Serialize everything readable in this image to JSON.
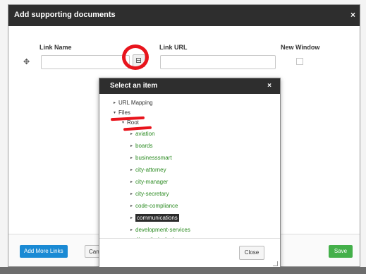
{
  "dialog": {
    "title": "Add supporting documents",
    "close_icon": "×",
    "columns": {
      "link_name": "Link Name",
      "link_url": "Link URL",
      "new_window": "New Window"
    },
    "row": {
      "link_name_value": "",
      "link_url_value": "",
      "new_window_checked": false
    },
    "add_row_icon": "✥",
    "buttons": {
      "add_more": "Add More Links",
      "cancel": "Canc",
      "save": "Save"
    }
  },
  "picker": {
    "title": "Select an item",
    "close_icon": "×",
    "tree": [
      {
        "label": "URL Mapping",
        "arrow": "▸",
        "level": 0,
        "color": "default"
      },
      {
        "label": "Files",
        "arrow": "▾",
        "level": 0,
        "color": "default"
      },
      {
        "label": "Root",
        "arrow": "▾",
        "level": 1,
        "color": "default"
      },
      {
        "label": "aviation",
        "arrow": "▸",
        "level": 2,
        "color": "green"
      },
      {
        "label": "boards",
        "arrow": "▸",
        "level": 2,
        "color": "green"
      },
      {
        "label": "businesssmart",
        "arrow": "▸",
        "level": 2,
        "color": "green"
      },
      {
        "label": "city-attorney",
        "arrow": "▸",
        "level": 2,
        "color": "green"
      },
      {
        "label": "city-manager",
        "arrow": "▸",
        "level": 2,
        "color": "green"
      },
      {
        "label": "city-secretary",
        "arrow": "▸",
        "level": 2,
        "color": "green"
      },
      {
        "label": "code-compliance",
        "arrow": "▸",
        "level": 2,
        "color": "green"
      },
      {
        "label": "communications",
        "arrow": "▸",
        "level": 2,
        "color": "green",
        "selected": true
      },
      {
        "label": "development-services",
        "arrow": "▸",
        "level": 2,
        "color": "green"
      },
      {
        "label": "diversity-inclusion",
        "arrow": "▸",
        "level": 2,
        "color": "green"
      }
    ],
    "close_button": "Close"
  },
  "colors": {
    "header_bg": "#2e2e2e",
    "primary": "#1a8ad4",
    "success": "#44b04a",
    "tree_link": "#2a8a20",
    "annotation": "#e8141c"
  }
}
